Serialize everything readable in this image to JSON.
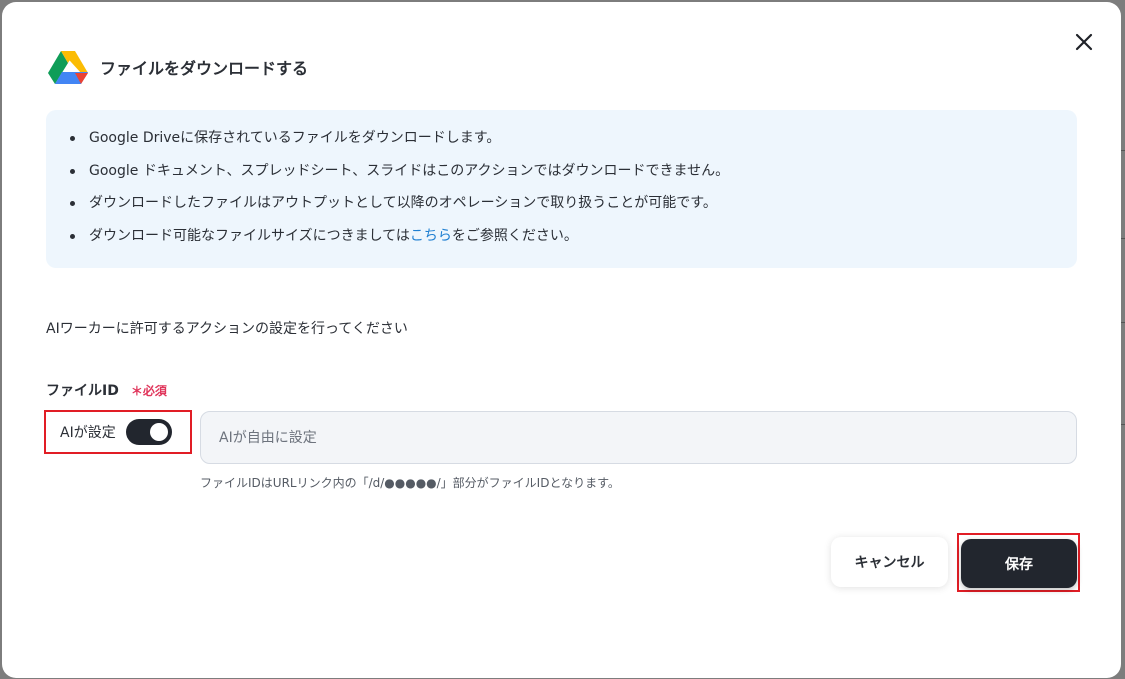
{
  "dialog": {
    "title": "ファイルをダウンロードする",
    "icon": "google-drive-icon"
  },
  "info": {
    "items": [
      "Google Driveに保存されているファイルをダウンロードします。",
      "Google ドキュメント、スプレッドシート、スライドはこのアクションではダウンロードできません。",
      "ダウンロードしたファイルはアウトプットとして以降のオペレーションで取り扱うことが可能です。"
    ],
    "last_prefix": "ダウンロード可能なファイルサイズにつきましては",
    "last_link": "こちら",
    "last_suffix": "をご参照ください。"
  },
  "instruction": "AIワーカーに許可するアクションの設定を行ってください",
  "field": {
    "label": "ファイルID",
    "required": "＊必須",
    "toggle_label": "AIが設定",
    "toggle_on": true,
    "placeholder": "AIが自由に設定",
    "value": "",
    "helper": "ファイルIDはURLリンク内の「/d/●●●●●/」部分がファイルIDとなります。"
  },
  "buttons": {
    "cancel": "キャンセル",
    "save": "保存"
  },
  "colors": {
    "accent_dark": "#22262e",
    "link": "#1f7fd1",
    "required": "#e0345a",
    "highlight": "#e11d25",
    "info_bg": "#eef6fd"
  }
}
